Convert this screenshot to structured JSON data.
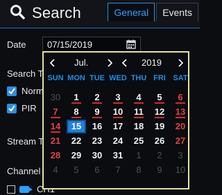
{
  "header": {
    "title": "Search",
    "icons": {
      "search": "search-icon"
    },
    "tabs": [
      {
        "label": "General",
        "active": true
      },
      {
        "label": "Events",
        "active": false
      }
    ]
  },
  "form": {
    "date_label": "Date",
    "date_value": "07/15/2019",
    "search_type_label": "Search T",
    "search_types": [
      {
        "label": "Norm",
        "checked": true
      },
      {
        "label": "PIR",
        "checked": true
      }
    ],
    "stream_label": "Stream T",
    "channel_label": "Channel",
    "channel_item_label": "CH1"
  },
  "calendar": {
    "month": "Jul.",
    "year": "2019",
    "weekdays": [
      "SUN",
      "MON",
      "TUE",
      "WED",
      "THU",
      "FRI",
      "SAT"
    ],
    "weeks": [
      [
        {
          "d": "30",
          "m": true
        },
        {
          "d": "1",
          "r": true
        },
        {
          "d": "2",
          "r": true
        },
        {
          "d": "3",
          "r": true
        },
        {
          "d": "4",
          "r": true
        },
        {
          "d": "5",
          "r": true
        },
        {
          "d": "6",
          "r": true,
          "w": true
        }
      ],
      [
        {
          "d": "7",
          "r": true,
          "w": true
        },
        {
          "d": "8",
          "r": true
        },
        {
          "d": "9",
          "r": true
        },
        {
          "d": "10",
          "r": true
        },
        {
          "d": "11",
          "r": true
        },
        {
          "d": "12",
          "r": true
        },
        {
          "d": "13",
          "r": true,
          "w": true
        }
      ],
      [
        {
          "d": "14",
          "r": true,
          "w": true
        },
        {
          "d": "15",
          "s": true
        },
        {
          "d": "16"
        },
        {
          "d": "17"
        },
        {
          "d": "18"
        },
        {
          "d": "19"
        },
        {
          "d": "20",
          "w": true
        }
      ],
      [
        {
          "d": "21",
          "w": true
        },
        {
          "d": "22"
        },
        {
          "d": "23"
        },
        {
          "d": "24"
        },
        {
          "d": "25"
        },
        {
          "d": "26"
        },
        {
          "d": "27",
          "w": true
        }
      ],
      [
        {
          "d": "28",
          "w": true
        },
        {
          "d": "29"
        },
        {
          "d": "30"
        },
        {
          "d": "31"
        },
        {
          "d": "1",
          "m": true
        },
        {
          "d": "2",
          "m": true
        },
        {
          "d": "3",
          "m": true
        }
      ],
      [
        {
          "d": "4",
          "m": true
        },
        {
          "d": "5",
          "m": true
        },
        {
          "d": "6",
          "m": true
        },
        {
          "d": "7",
          "m": true
        },
        {
          "d": "8",
          "m": true
        },
        {
          "d": "9",
          "m": true
        },
        {
          "d": "10",
          "m": true
        }
      ]
    ]
  },
  "colors": {
    "accent": "#2a8fe6",
    "weekday": "#1b8ee8",
    "weekend": "#e04444",
    "record_marker": "#d62b2b",
    "popup_border": "#e4e4a0",
    "selected_day": "#1f7fe0"
  }
}
